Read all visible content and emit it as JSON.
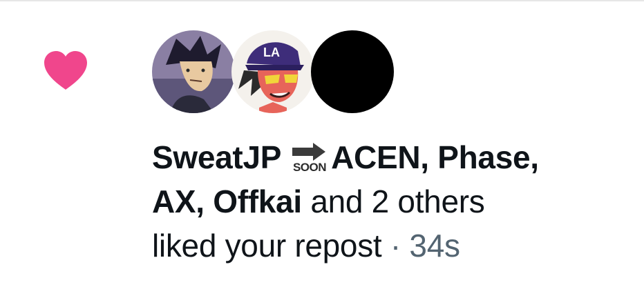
{
  "notification": {
    "type_icon": "heart-icon",
    "accent_color": "#f0468c",
    "avatars": [
      {
        "name": "avatar-user-1",
        "description": "anime-avatar"
      },
      {
        "name": "avatar-user-2",
        "description": "anime-avatar-la-cap"
      },
      {
        "name": "avatar-user-3",
        "description": "black-avatar"
      }
    ],
    "actor_1": "SweatJP",
    "actor_1_emoji": "soon-arrow-icon",
    "actor_1_suffix": "ACEN, Phase,",
    "actor_2": "AX, Offkai",
    "others_text": "and 2 others",
    "action_text": "liked your repost",
    "separator": "·",
    "timestamp": "34s"
  }
}
